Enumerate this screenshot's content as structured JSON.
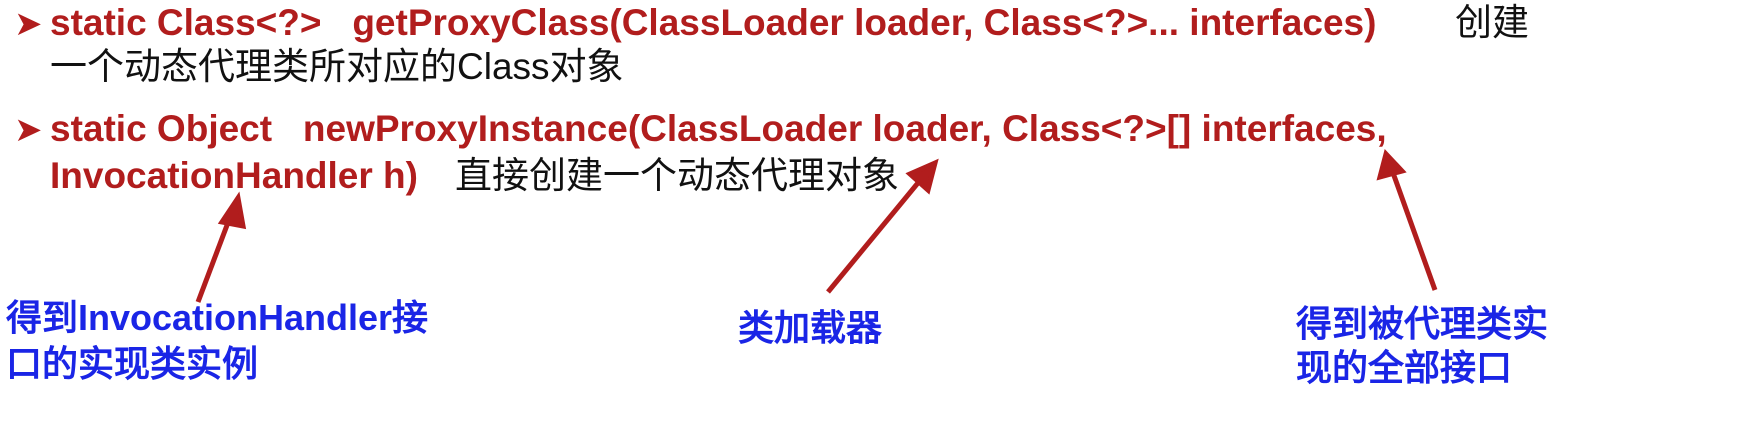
{
  "method1": {
    "signature": "static Class<?>   getProxyClass(ClassLoader loader, Class<?>... interfaces)",
    "desc_part1": "创建",
    "desc_part2": "一个动态代理类所对应的Class对象"
  },
  "method2": {
    "signature_line1": "static Object   newProxyInstance(ClassLoader loader, Class<?>[] interfaces,",
    "signature_line2": "InvocationHandler h)",
    "desc": "直接创建一个动态代理对象"
  },
  "annotations": {
    "handler_line1": "得到InvocationHandler接",
    "handler_line2": "口的实现类实例",
    "classloader": "类加载器",
    "interfaces_line1": "得到被代理类实",
    "interfaces_line2": "现的全部接口"
  },
  "colors": {
    "accent_red": "#b11d1d",
    "annotation_blue": "#1a25e6",
    "text": "#111111"
  },
  "bullet_icon": "arrowhead-bullet"
}
